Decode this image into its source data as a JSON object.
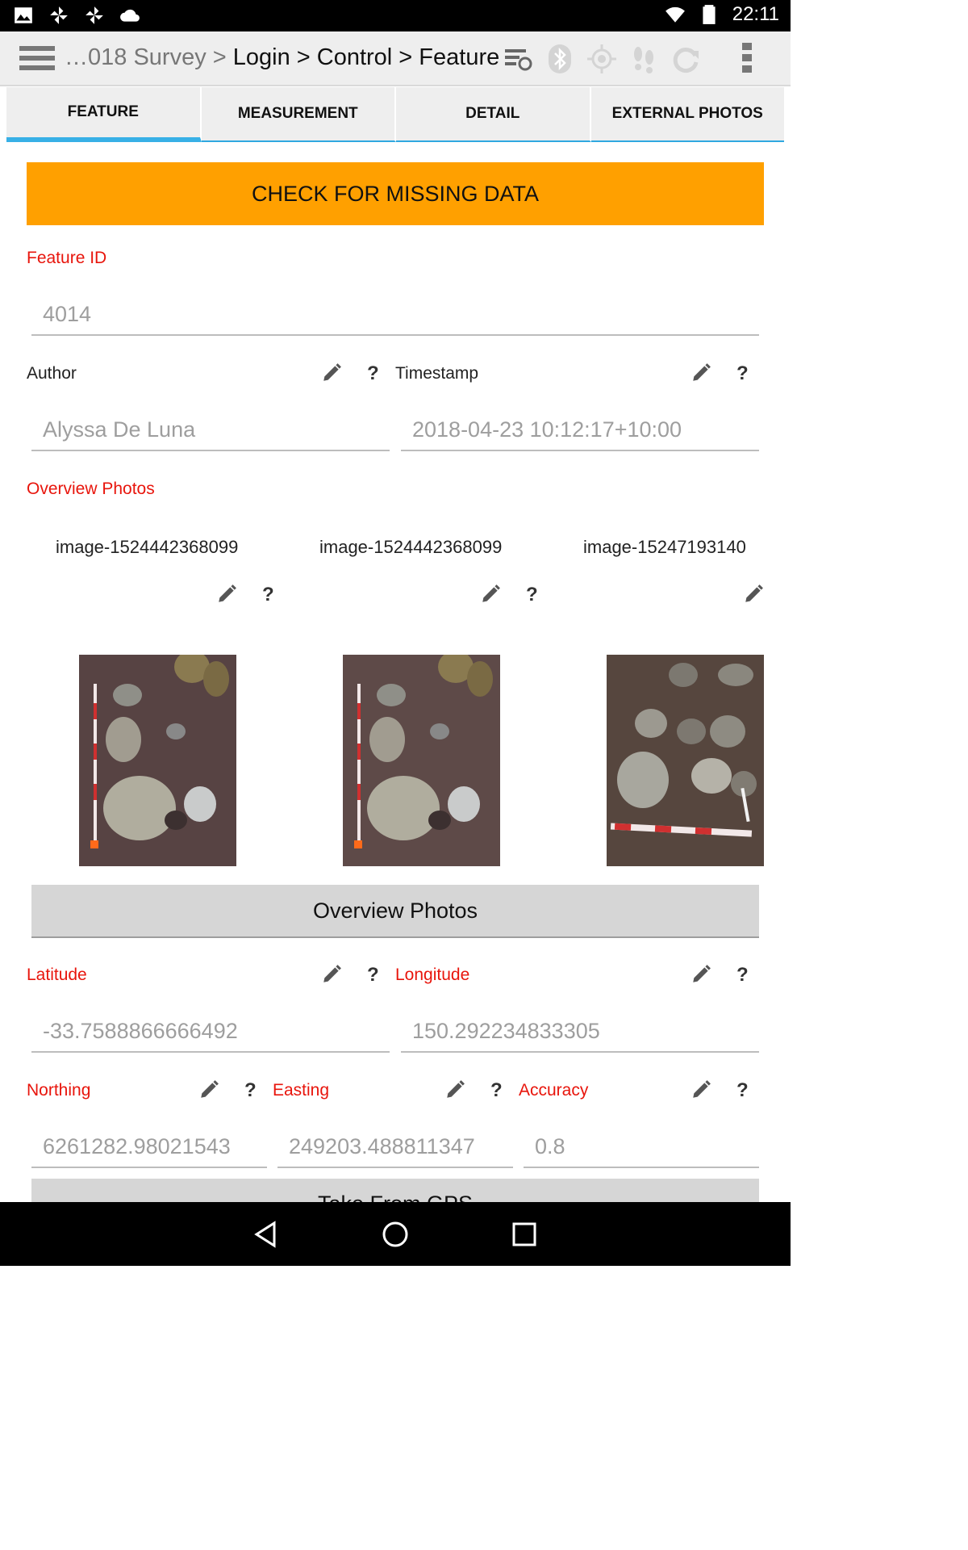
{
  "status_bar": {
    "time": "22:11",
    "left_icons": [
      "image-icon",
      "pinwheel-icon",
      "pinwheel-icon",
      "cloud-icon"
    ],
    "right_icons": [
      "wifi-icon",
      "battery-icon"
    ]
  },
  "toolbar": {
    "breadcrumb_dim": "…018 Survey >",
    "breadcrumb_main": " Login > Control > Feature",
    "icons": [
      "sync-list-icon",
      "bluetooth-icon",
      "gps-icon",
      "footsteps-icon",
      "refresh-icon"
    ]
  },
  "tabs": [
    {
      "label": "FEATURE",
      "active": true
    },
    {
      "label": "MEASUREMENT",
      "active": false
    },
    {
      "label": "DETAIL",
      "active": false
    },
    {
      "label": "EXTERNAL PHOTOS",
      "active": false
    }
  ],
  "check_button": "CHECK FOR MISSING DATA",
  "feature_id": {
    "label": "Feature ID",
    "value": "4014"
  },
  "author": {
    "label": "Author",
    "value": "Alyssa De Luna"
  },
  "timestamp": {
    "label": "Timestamp",
    "value": "2018-04-23 10:12:17+10:00"
  },
  "overview_photos": {
    "label": "Overview Photos",
    "images": [
      {
        "name": "image-1524442368099"
      },
      {
        "name": "image-1524442368099"
      },
      {
        "name": "image-15247193140"
      }
    ],
    "button": "Overview Photos"
  },
  "latitude": {
    "label": "Latitude",
    "value": "-33.7588866666492"
  },
  "longitude": {
    "label": "Longitude",
    "value": "150.292234833305"
  },
  "northing": {
    "label": "Northing",
    "value": "6261282.98021543"
  },
  "easting": {
    "label": "Easting",
    "value": "249203.488811347"
  },
  "accuracy": {
    "label": "Accuracy",
    "value": "0.8"
  },
  "gps_button": "Take From GPS",
  "help_symbol": "?",
  "colors": {
    "accent": "#ffa000",
    "tab_indicator": "#38b0e6",
    "required_label": "#e8150c"
  },
  "nav_bar": [
    "back-icon",
    "home-icon",
    "recents-icon"
  ]
}
